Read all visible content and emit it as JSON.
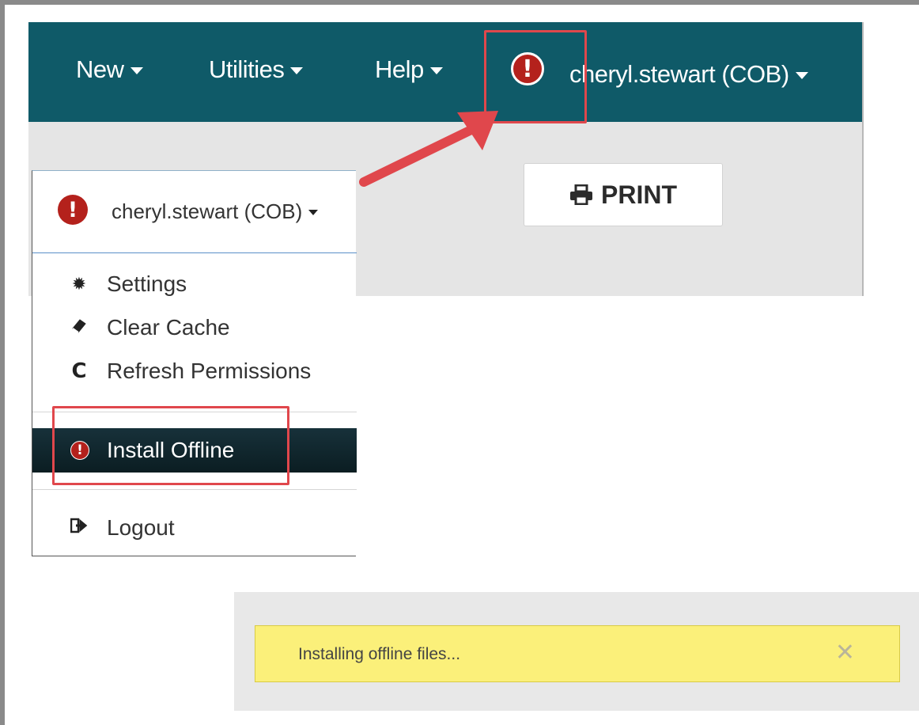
{
  "navbar": {
    "items": [
      {
        "label": "New"
      },
      {
        "label": "Utilities"
      },
      {
        "label": "Help"
      }
    ],
    "alert_icon": "exclamation-circle-icon",
    "user_label": "cheryl.stewart (COB)",
    "background": "#0f5a68"
  },
  "toolbar": {
    "print_label": "PRINT",
    "print_icon": "print-icon"
  },
  "user_menu": {
    "header_user": "cheryl.stewart (COB)",
    "items": [
      {
        "label": "Settings",
        "icon": "gear-icon"
      },
      {
        "label": "Clear Cache",
        "icon": "eraser-icon"
      },
      {
        "label": "Refresh Permissions",
        "icon": "refresh-icon"
      },
      {
        "label": "Install Offline",
        "icon": "exclamation-circle-icon"
      },
      {
        "label": "Logout",
        "icon": "sign-out-icon"
      }
    ]
  },
  "notification": {
    "message": "Installing offline files...",
    "close_icon": "close-icon",
    "background": "#fbf07a"
  },
  "colors": {
    "alert": "#b4211c",
    "highlight": "#e0474c"
  }
}
